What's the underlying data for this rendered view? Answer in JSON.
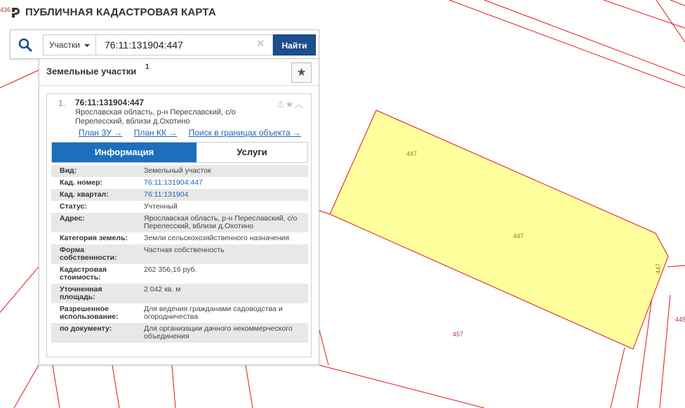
{
  "app": {
    "title": "ПУБЛИЧНАЯ КАДАСТРОВАЯ КАРТА"
  },
  "search": {
    "type_label": "Участки",
    "query": "76:11:131904:447",
    "find_label": "Найти"
  },
  "panel": {
    "title": "Земельные участки",
    "count": "1"
  },
  "result": {
    "index": "1.",
    "cad_number": "76:11:131904:447",
    "address": "Ярославская область, р-н Переславский, с/о Перелесский, вблизи д.Охотино",
    "links": [
      "План ЗУ →",
      "План КК →",
      "Поиск в границах объекта →"
    ],
    "tabs": {
      "info": "Информация",
      "services": "Услуги"
    },
    "attributes": [
      {
        "key": "Вид:",
        "value": "Земельный участок"
      },
      {
        "key": "Кад. номер:",
        "value": "76:11:131904:447",
        "link": true
      },
      {
        "key": "Кад. квартал:",
        "value": "76:11:131904",
        "link": true
      },
      {
        "key": "Статус:",
        "value": "Учтенный"
      },
      {
        "key": "Адрес:",
        "value": "Ярославская область, р-н Переславский, с/о Перелесский, вблизи д.Охотино"
      },
      {
        "key": "Категория земель:",
        "value": "Земли сельскохозяйственного назначения"
      },
      {
        "key": "Форма собственности:",
        "value": "Частная собственность"
      },
      {
        "key": "Кадастровая стоимость:",
        "value": "262 356,16 руб."
      },
      {
        "key": "Уточненная площадь:",
        "value": "2 042 кв. м"
      },
      {
        "key": "Разрешенное использование:",
        "value": "Для ведения гражданами садоводства и огородничества"
      },
      {
        "key": "по документу:",
        "value": "Для организации дачного некоммерческого объединения"
      }
    ]
  },
  "map": {
    "labels": {
      "p1": "447",
      "p2": "447",
      "p3": "447",
      "p4": "457",
      "p5": "445",
      "p6": "436"
    },
    "parcel_fill": "#ffff9e",
    "line_color": "#e0161c"
  }
}
